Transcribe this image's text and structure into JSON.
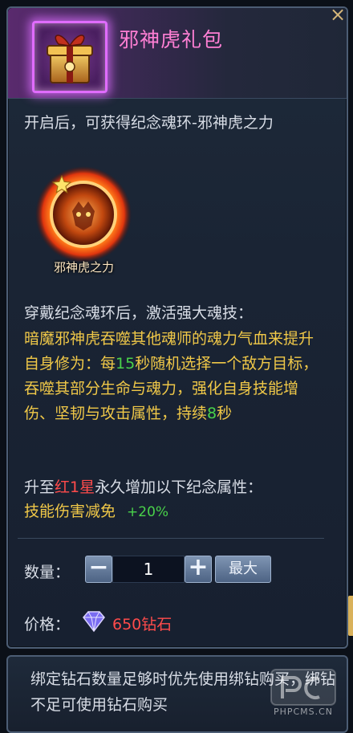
{
  "item": {
    "title": "邪神虎礼包",
    "close_icon": "close-icon"
  },
  "description": "开启后，可获得纪念魂环-邪神虎之力",
  "reward": {
    "label": "邪神虎之力",
    "icon": "tiger-soul-ring-icon",
    "badge_icon": "star-icon"
  },
  "skill": {
    "intro": "穿戴纪念魂环后，激活强大魂技：",
    "text_part1": "暗魔邪神虎吞噬其他魂师的魂力气血来提升自身修为：每",
    "seconds": "15",
    "text_part2": "秒随机选择一个敌方目标，吞噬其部分生命与魂力，强化自身技能增伤、坚韧与攻击属性，持续",
    "duration": "8",
    "text_part3": "秒"
  },
  "upgrade": {
    "prefix": "升至",
    "star": "红1星",
    "suffix": "永久增加以下纪念属性：",
    "attr_name": "技能伤害减免",
    "attr_value": "+20%"
  },
  "purchase": {
    "qty_label": "数量：",
    "qty_value": "1",
    "minus_label": "−",
    "plus_label": "+",
    "max_label": "最大",
    "price_label": "价格：",
    "price_value": "650钻石",
    "currency_icon": "diamond-icon"
  },
  "footer": {
    "note": "绑定钻石数量足够时优先使用绑钻购买，绑钻不足可使用钻石购买"
  },
  "watermark": {
    "text": "PHPCMS.CN"
  },
  "colors": {
    "title": "#ff7fd4",
    "highlight": "#f0c848",
    "green": "#49d24a",
    "red": "#ff4b4b"
  }
}
